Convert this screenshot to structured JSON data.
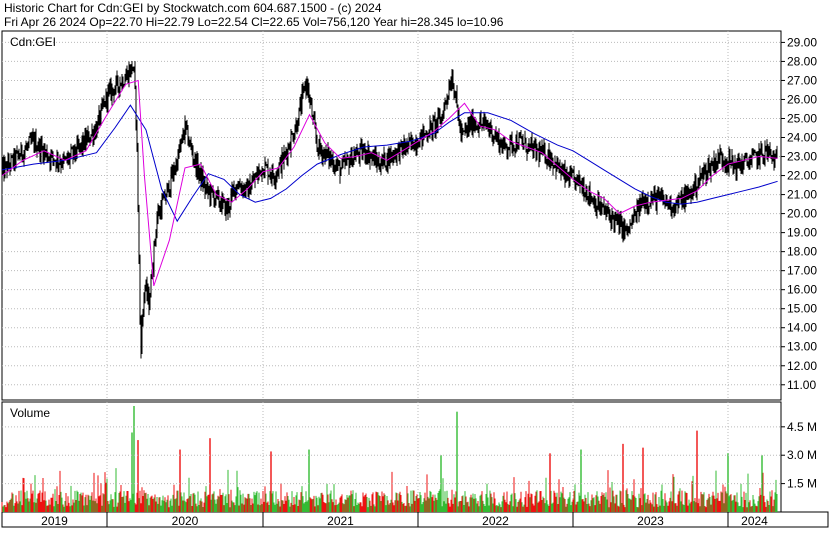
{
  "header": {
    "line1": "Historic Chart for Cdn:GEI by Stockwatch.com 604.687.1500 - (c) 2024",
    "line2": "Fri Apr 26 2024    Op=22.70   Hi=22.79   Lo=22.54   Cl=22.65   Vol=756,120   Year hi=28.345   lo=10.96"
  },
  "chart_data": [
    {
      "type": "line",
      "title": "Cdn:GEI",
      "ylim": [
        10.2,
        29.6
      ],
      "y_ticks": [
        "29.00",
        "28.00",
        "27.00",
        "26.00",
        "25.00",
        "24.00",
        "23.00",
        "22.00",
        "21.00",
        "20.00",
        "19.00",
        "18.00",
        "17.00",
        "16.00",
        "15.00",
        "14.00",
        "13.00",
        "12.00",
        "11.00"
      ],
      "x_labels": [
        "2019",
        "2020",
        "2021",
        "2022",
        "2023",
        "2024"
      ],
      "grid": true,
      "colors": {
        "price": "#000000",
        "ma_short": "#dd00dd",
        "ma_long": "#0000cc"
      },
      "series": [
        {
          "key": "close",
          "x": [
            2019.0,
            2019.15,
            2019.3,
            2019.45,
            2019.6,
            2019.75,
            2019.9,
            2020.0,
            2020.12,
            2020.17,
            2020.19,
            2020.215,
            2020.24,
            2020.27,
            2020.32,
            2020.38,
            2020.45,
            2020.5,
            2020.56,
            2020.63,
            2020.7,
            2020.77,
            2020.83,
            2020.9,
            2021.0,
            2021.07,
            2021.14,
            2021.22,
            2021.28,
            2021.35,
            2021.42,
            2021.5,
            2021.58,
            2021.66,
            2021.75,
            2021.85,
            2021.95,
            2022.05,
            2022.15,
            2022.22,
            2022.28,
            2022.35,
            2022.45,
            2022.55,
            2022.65,
            2022.75,
            2022.85,
            2022.95,
            2023.05,
            2023.15,
            2023.25,
            2023.35,
            2023.45,
            2023.55,
            2023.65,
            2023.75,
            2023.85,
            2023.95,
            2024.05,
            2024.15,
            2024.25,
            2024.32
          ],
          "values": [
            22.2,
            23.0,
            23.8,
            23.0,
            22.7,
            23.5,
            24.5,
            26.2,
            27.2,
            27.8,
            24.5,
            12.8,
            16.2,
            15.3,
            19.8,
            21.0,
            22.8,
            24.5,
            22.8,
            21.3,
            20.8,
            20.2,
            21.6,
            21.2,
            22.5,
            22.0,
            23.0,
            24.8,
            27.0,
            23.5,
            23.0,
            22.3,
            23.0,
            23.3,
            22.6,
            23.2,
            23.6,
            24.2,
            25.0,
            27.3,
            24.0,
            24.8,
            24.6,
            23.5,
            23.8,
            23.3,
            23.0,
            21.9,
            21.6,
            20.5,
            19.8,
            19.0,
            20.7,
            20.8,
            20.4,
            21.0,
            22.2,
            23.0,
            22.5,
            22.8,
            23.3,
            22.6
          ]
        },
        {
          "key": "ma_short",
          "x": [
            2019.0,
            2019.2,
            2019.4,
            2019.6,
            2019.8,
            2020.0,
            2020.12,
            2020.2,
            2020.24,
            2020.3,
            2020.4,
            2020.5,
            2020.6,
            2020.7,
            2020.8,
            2020.9,
            2021.0,
            2021.1,
            2021.2,
            2021.3,
            2021.4,
            2021.5,
            2021.6,
            2021.7,
            2021.8,
            2021.9,
            2022.0,
            2022.1,
            2022.2,
            2022.3,
            2022.4,
            2022.5,
            2022.6,
            2022.7,
            2022.8,
            2022.9,
            2023.0,
            2023.1,
            2023.2,
            2023.3,
            2023.4,
            2023.5,
            2023.6,
            2023.7,
            2023.8,
            2023.9,
            2024.0,
            2024.1,
            2024.2,
            2024.32
          ],
          "values": [
            22.0,
            22.8,
            23.3,
            22.8,
            23.3,
            25.2,
            26.8,
            27.0,
            22.0,
            16.2,
            18.6,
            22.4,
            22.6,
            21.0,
            20.6,
            21.3,
            22.2,
            22.4,
            23.5,
            25.2,
            23.7,
            22.9,
            23.0,
            23.2,
            22.8,
            23.3,
            23.8,
            24.3,
            25.0,
            25.8,
            24.6,
            24.4,
            23.8,
            23.5,
            23.2,
            22.5,
            21.8,
            21.2,
            20.8,
            20.0,
            20.4,
            20.6,
            20.7,
            20.8,
            21.2,
            22.0,
            22.6,
            22.8,
            23.0,
            22.9
          ]
        },
        {
          "key": "ma_long",
          "x": [
            2019.0,
            2019.3,
            2019.6,
            2019.9,
            2020.05,
            2020.15,
            2020.25,
            2020.35,
            2020.45,
            2020.55,
            2020.65,
            2020.75,
            2020.85,
            2020.95,
            2021.05,
            2021.15,
            2021.25,
            2021.35,
            2021.5,
            2021.65,
            2021.8,
            2021.95,
            2022.1,
            2022.2,
            2022.3,
            2022.45,
            2022.6,
            2022.75,
            2022.9,
            2023.0,
            2023.1,
            2023.2,
            2023.3,
            2023.4,
            2023.5,
            2023.6,
            2023.7,
            2023.8,
            2023.9,
            2024.0,
            2024.1,
            2024.2,
            2024.32
          ],
          "values": [
            22.3,
            22.6,
            22.8,
            23.2,
            24.5,
            25.7,
            24.4,
            21.3,
            19.6,
            20.9,
            22.1,
            21.8,
            21.0,
            20.6,
            20.8,
            21.3,
            22.0,
            22.6,
            23.1,
            23.5,
            23.6,
            23.8,
            24.2,
            24.8,
            25.3,
            25.3,
            24.9,
            24.2,
            23.6,
            23.3,
            22.8,
            22.3,
            21.8,
            21.3,
            20.9,
            20.6,
            20.5,
            20.6,
            20.8,
            21.0,
            21.2,
            21.4,
            21.7
          ]
        }
      ]
    },
    {
      "type": "bar",
      "title": "Volume",
      "y_ticks": [
        "4.5 M",
        "3.0 M",
        "1.5 M"
      ],
      "ylim": [
        0,
        5.6
      ],
      "colors": {
        "up": "#33bb33",
        "down": "#ee1111"
      },
      "spikes": [
        {
          "x": 2020.17,
          "value": 5.6,
          "dir": "up"
        },
        {
          "x": 2020.16,
          "value": 4.2,
          "dir": "up"
        },
        {
          "x": 2020.2,
          "value": 3.8,
          "dir": "down"
        },
        {
          "x": 2020.47,
          "value": 3.3,
          "dir": "down"
        },
        {
          "x": 2020.66,
          "value": 3.9,
          "dir": "down"
        },
        {
          "x": 2021.05,
          "value": 3.2,
          "dir": "down"
        },
        {
          "x": 2021.3,
          "value": 3.3,
          "dir": "up"
        },
        {
          "x": 2022.25,
          "value": 5.3,
          "dir": "up"
        },
        {
          "x": 2022.15,
          "value": 3.0,
          "dir": "up"
        },
        {
          "x": 2022.85,
          "value": 3.1,
          "dir": "down"
        },
        {
          "x": 2023.05,
          "value": 3.3,
          "dir": "up"
        },
        {
          "x": 2023.32,
          "value": 3.6,
          "dir": "down"
        },
        {
          "x": 2023.45,
          "value": 3.4,
          "dir": "down"
        },
        {
          "x": 2023.8,
          "value": 4.3,
          "dir": "down"
        },
        {
          "x": 2024.0,
          "value": 3.1,
          "dir": "up"
        },
        {
          "x": 2024.22,
          "value": 3.0,
          "dir": "up"
        }
      ]
    }
  ]
}
